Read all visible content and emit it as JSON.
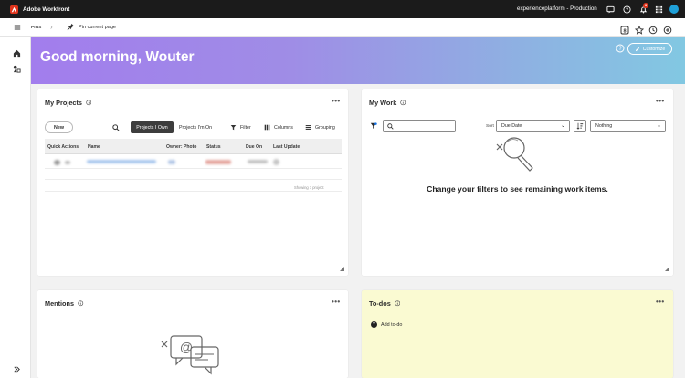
{
  "app": {
    "title": "Adobe Workfront",
    "org": "experienceplatform - Production",
    "notification_count": "3"
  },
  "pins_bar": {
    "pins_label": "PINS",
    "pin_current_page": "Pin current page"
  },
  "hero": {
    "greeting": "Good morning, Wouter",
    "customize_label": "Customize"
  },
  "my_projects": {
    "title": "My Projects",
    "new_label": "New",
    "tabs": [
      "Projects I Own",
      "Projects I'm On"
    ],
    "filter_label": "Filter",
    "columns_label": "Columns",
    "grouping_label": "Grouping",
    "headers": [
      "Quick Actions",
      "Name",
      "Owner: Photo",
      "Status",
      "Due On",
      "Last Update"
    ],
    "footer": "Showing 1 project"
  },
  "my_work": {
    "title": "My Work",
    "sort_label": "Sort",
    "sort_value": "Due Date",
    "group_value": "Nothing",
    "empty_message": "Change your filters to see remaining work items."
  },
  "mentions": {
    "title": "Mentions"
  },
  "todos": {
    "title": "To-dos",
    "add_label": "Add to-do"
  },
  "colors": {
    "accent": "#1fa0d8",
    "brand": "#e0341c",
    "todo_bg": "#fafad2"
  }
}
